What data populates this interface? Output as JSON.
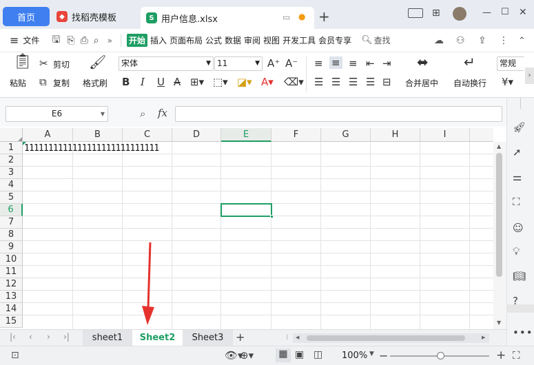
{
  "tabs": {
    "home": "首页",
    "template": "找稻壳模板",
    "file": "用户信息.xlsx",
    "add": "+"
  },
  "window": {
    "layout_icon": "layout-icon",
    "grid_icon": "apps-grid-icon",
    "minimize": "—",
    "maximize": "☐",
    "close": "✕"
  },
  "menu": {
    "hamburger": "≡",
    "file": "文件",
    "more": "»",
    "items": [
      "开始",
      "插入",
      "页面布局",
      "公式",
      "数据",
      "审阅",
      "视图",
      "开发工具",
      "会员专享"
    ],
    "search": "查找",
    "more_dots": "⋮",
    "collapse": "⌃"
  },
  "ribbon": {
    "paste": "粘贴",
    "cut": "剪切",
    "copy": "复制",
    "format_painter": "格式刷",
    "font_name": "宋体",
    "font_size": "11",
    "bold": "B",
    "italic": "I",
    "underline": "U",
    "strike": "A",
    "merge_center": "合并居中",
    "wrap_text": "自动换行",
    "number_format": "常规",
    "currency": "¥"
  },
  "formula_bar": {
    "name_box": "E6",
    "fx": "fx",
    "formula": ""
  },
  "columns": [
    "A",
    "B",
    "C",
    "D",
    "E",
    "F",
    "G",
    "H",
    "I"
  ],
  "rows": [
    "1",
    "2",
    "3",
    "4",
    "5",
    "6",
    "7",
    "8",
    "9",
    "10",
    "11",
    "12",
    "13",
    "14",
    "15"
  ],
  "active_cell": "E6",
  "cells": {
    "A1": "1111111111111111111111111111"
  },
  "sheets": [
    "sheet1",
    "Sheet2",
    "Sheet3"
  ],
  "active_sheet": "Sheet2",
  "status": {
    "zoom": "100%",
    "minus": "−",
    "plus": "+"
  },
  "colors": {
    "accent": "#1e9e63",
    "tab_blue": "#3f7ff0",
    "arrow": "#e5322d"
  }
}
